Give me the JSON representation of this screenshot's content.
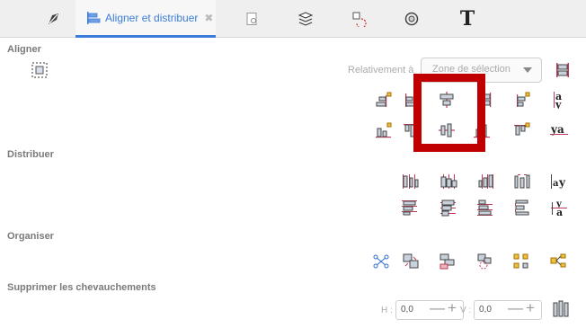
{
  "tabs": [
    {
      "name": "fill-stroke",
      "icon": "fill-stroke-icon"
    },
    {
      "name": "align",
      "label": "Aligner et distribuer",
      "icon": "align-icon",
      "active": true
    },
    {
      "name": "document",
      "icon": "document-properties-icon"
    },
    {
      "name": "layers",
      "icon": "layers-icon"
    },
    {
      "name": "transform",
      "icon": "transform-icon"
    },
    {
      "name": "objects",
      "icon": "objects-icon"
    },
    {
      "name": "text",
      "icon": "text-icon",
      "glyph": "T"
    }
  ],
  "sections": {
    "align": "Aligner",
    "distribute": "Distribuer",
    "arrange": "Organiser",
    "overlap": "Supprimer les chevauchements"
  },
  "relative": {
    "label": "Relativement à",
    "value": "Zone de sélection"
  },
  "overlap": {
    "h_label": "H :",
    "h_value": "0,0",
    "v_label": "V :",
    "v_value": "0,0"
  },
  "accent_color": "#3c7dd9",
  "highlight_color": "#c00000"
}
